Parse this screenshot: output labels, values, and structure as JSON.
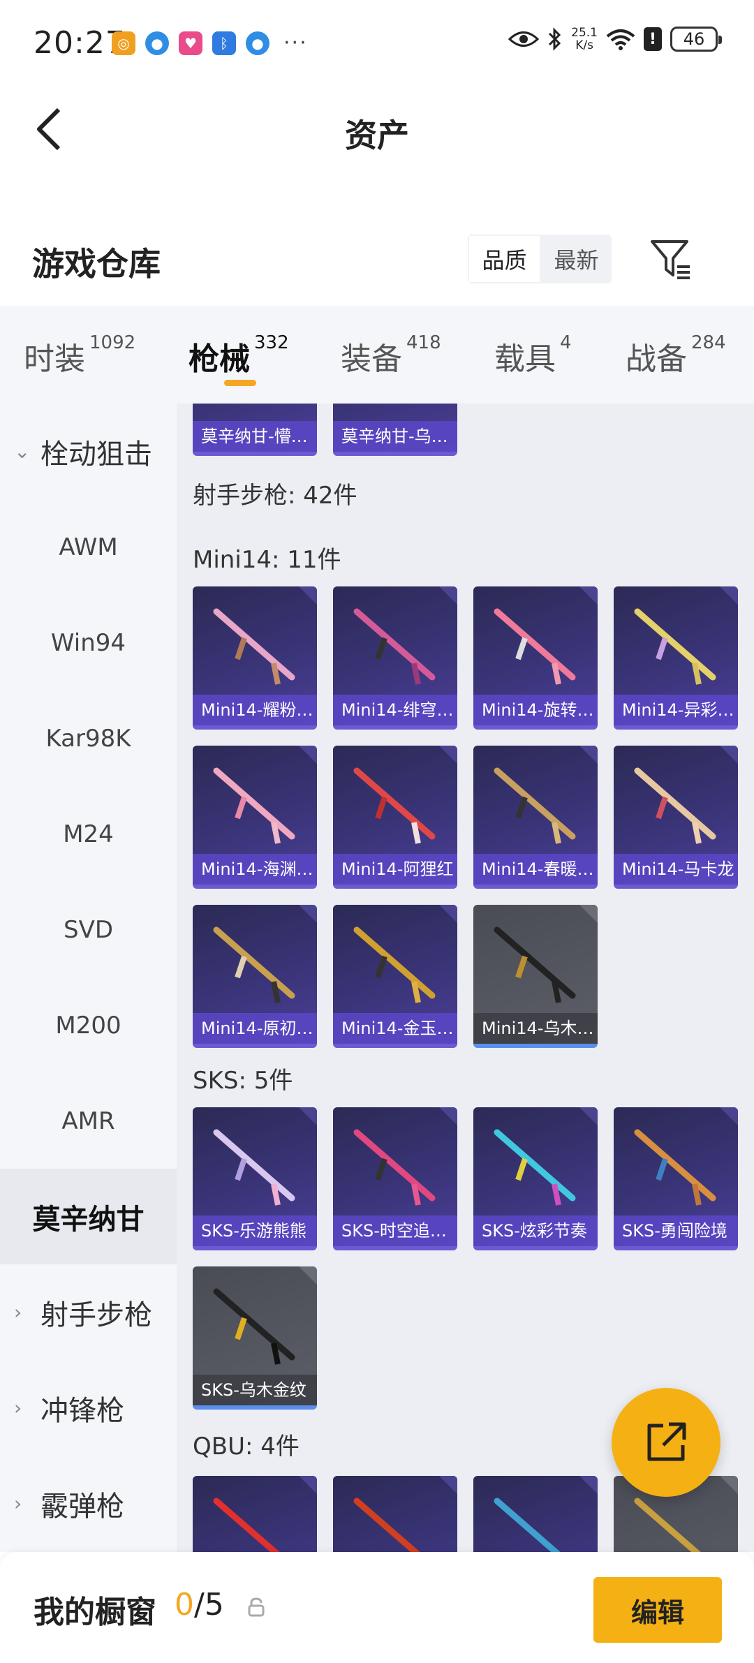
{
  "status_bar": {
    "time": "20:27",
    "net_speed_value": "25.1",
    "net_speed_unit": "K/s",
    "battery": "46",
    "more": "···"
  },
  "header": {
    "title": "资产"
  },
  "warehouse": {
    "title": "游戏仓库",
    "sort_options": [
      "品质",
      "最新"
    ],
    "sort_active": "品质"
  },
  "tabs": [
    {
      "label": "时装",
      "count": "1092"
    },
    {
      "label": "枪械",
      "count": "332",
      "active": true
    },
    {
      "label": "装备",
      "count": "418"
    },
    {
      "label": "载具",
      "count": "4"
    },
    {
      "label": "战备",
      "count": "284"
    }
  ],
  "sidebar": {
    "groups": {
      "bolt_sniper": "栓动狙击",
      "marksman": "射手步枪",
      "smg": "冲锋枪",
      "shotgun": "霰弹枪"
    },
    "items": [
      "AWM",
      "Win94",
      "Kar98K",
      "M24",
      "SVD",
      "M200",
      "AMR",
      "莫辛纳甘"
    ],
    "active_item": "莫辛纳甘"
  },
  "content": {
    "top_cards": [
      "莫辛纳甘-懵…",
      "莫辛纳甘-乌…"
    ],
    "marksman_title": "射手步枪: 42件",
    "mini14_title": "Mini14: 11件",
    "mini14_cards": [
      "Mini14-耀粉…",
      "Mini14-绯穹…",
      "Mini14-旋转…",
      "Mini14-异彩…",
      "Mini14-海渊…",
      "Mini14-阿狸红",
      "Mini14-春暖…",
      "Mini14-马卡龙",
      "Mini14-原初…",
      "Mini14-金玉…",
      "Mini14-乌木…"
    ],
    "sks_title": "SKS: 5件",
    "sks_cards": [
      "SKS-乐游熊熊",
      "SKS-时空追…",
      "SKS-炫彩节奏",
      "SKS-勇闯险境",
      "SKS-乌木金纹"
    ],
    "qbu_title": "QBU: 4件"
  },
  "bottom_bar": {
    "title": "我的橱窗",
    "current": "0",
    "total": "/5",
    "edit_label": "编辑"
  },
  "colors": {
    "accent": "#f5b014",
    "card_purple": "#3a3478",
    "card_gray": "#555760"
  }
}
